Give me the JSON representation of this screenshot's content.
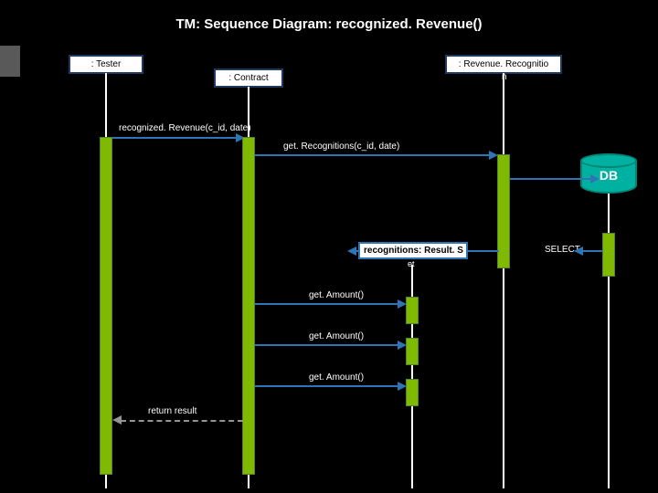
{
  "title": "TM: Sequence Diagram: recognized. Revenue()",
  "participants": {
    "tester": ": Tester",
    "contract": ": Contract",
    "revrec": ": Revenue. Recognitio",
    "revrec_sub": "n"
  },
  "messages": {
    "m1": "recognized. Revenue(c_id, date)",
    "m2": "get. Recognitions(c_id, date)",
    "select": "SELECT",
    "ga1": "get. Amount()",
    "ga2": "get. Amount()",
    "ga3": "get. Amount()",
    "return": "return result"
  },
  "result_box": "recognitions: Result. S",
  "result_sub": "et",
  "db_label": "DB"
}
